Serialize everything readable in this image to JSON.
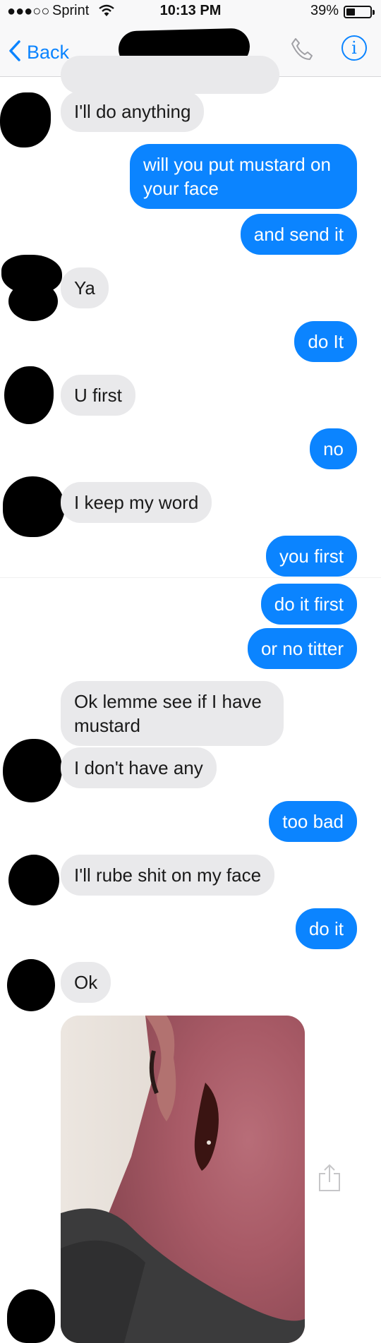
{
  "status_bar": {
    "signal": "●●●○○",
    "carrier": "Sprint",
    "time": "10:13 PM",
    "battery": "39%",
    "battery_level": 0.39
  },
  "nav": {
    "back_label": "Back",
    "info_glyph": "i",
    "icons": [
      "chevron-left-icon",
      "phone-icon",
      "info-icon"
    ]
  },
  "messages": [
    {
      "from": "them",
      "text": "I'll do anything"
    },
    {
      "from": "me",
      "text": "will you put mustard on your face"
    },
    {
      "from": "me",
      "text": "and send it"
    },
    {
      "from": "them",
      "text": "Ya"
    },
    {
      "from": "me",
      "text": "do It"
    },
    {
      "from": "them",
      "text": "U first"
    },
    {
      "from": "me",
      "text": "no"
    },
    {
      "from": "them",
      "text": "I keep my word"
    },
    {
      "from": "me",
      "text": "you first"
    },
    {
      "from": "me",
      "text": "do it first"
    },
    {
      "from": "me",
      "text": "or no titter"
    },
    {
      "from": "them",
      "text": "Ok lemme see if I have mustard"
    },
    {
      "from": "them",
      "text": "I don't have any"
    },
    {
      "from": "me",
      "text": "too bad"
    },
    {
      "from": "them",
      "text": "I'll rube shit on my face"
    },
    {
      "from": "me",
      "text": "do it"
    },
    {
      "from": "them",
      "text": "Ok"
    }
  ],
  "colors": {
    "outgoing_bubble": "#0b84ff",
    "incoming_bubble": "#e9e9eb",
    "accent": "#0b84ff"
  }
}
